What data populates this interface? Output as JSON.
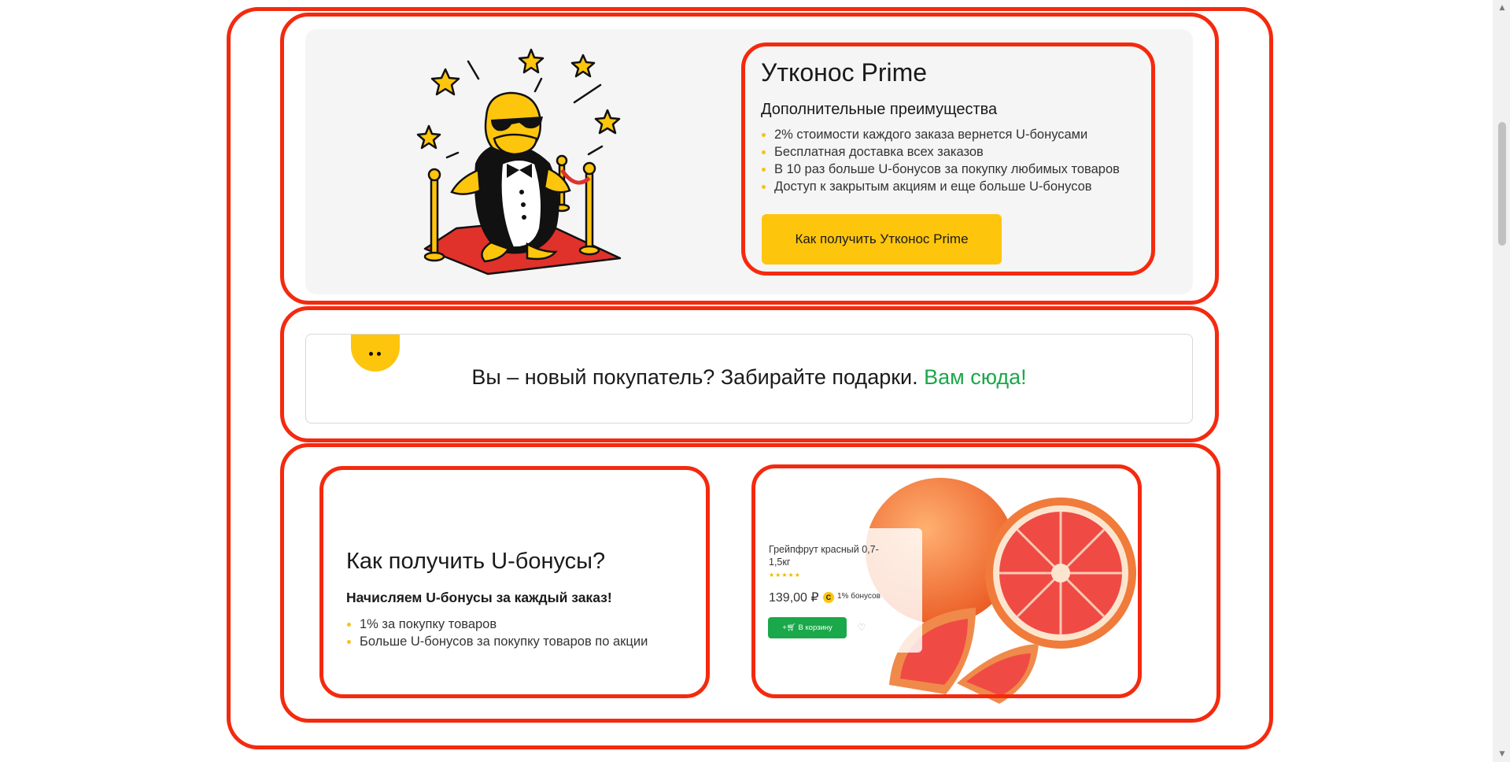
{
  "prime": {
    "title": "Утконос Prime",
    "subtitle": "Дополнительные преимущества",
    "benefits": [
      "2% стоимости каждого заказа вернется U-бонусами",
      "Бесплатная доставка всех заказов",
      "В 10 раз больше U-бонусов за покупку любимых товаров",
      "Доступ к закрытым акциям и еще больше U-бонусов"
    ],
    "button_label": "Как получить Утконос Prime"
  },
  "banner": {
    "text": "Вы – новый покупатель? Забирайте подарки.",
    "link_text": "Вам сюда!"
  },
  "ubonus": {
    "title": "Как получить U-бонусы?",
    "subtitle": "Начисляем U-бонусы за каждый заказ!",
    "items": [
      "1% за покупку товаров",
      "Больше U-бонусов за покупку товаров по акции"
    ]
  },
  "product": {
    "name": "Грейпфрут красный 0,7-1,5кг",
    "rating": 5,
    "price": "139,00 ₽",
    "bonus_badge": "С",
    "bonus_text": "1% бонусов",
    "cart_button_label": "В корзину",
    "cart_icon": "cart-plus-icon",
    "favorite_icon": "heart-icon"
  },
  "colors": {
    "annotation_red": "#f42a0f",
    "brand_yellow": "#fec50d",
    "link_green": "#1aa84a",
    "card_gray": "#f4f5f4"
  }
}
